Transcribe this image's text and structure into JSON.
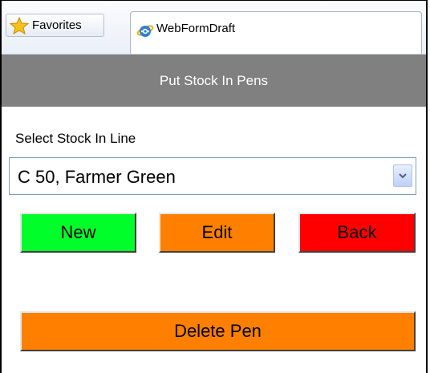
{
  "browser": {
    "favorites_label": "Favorites",
    "tab_title": "WebFormDraft",
    "icons": {
      "favorites": "star-icon",
      "tab": "ie-icon"
    }
  },
  "page": {
    "header_title": "Put Stock In Pens",
    "select_label": "Select Stock In Line",
    "dropdown": {
      "selected_value": "C 50, Farmer Green"
    },
    "buttons": {
      "new_label": "New",
      "edit_label": "Edit",
      "back_label": "Back",
      "delete_label": "Delete Pen"
    }
  },
  "colors": {
    "header_bg": "#808080",
    "new_button": "#00ff2a",
    "edit_button": "#ff8000",
    "back_button": "#ff0000",
    "delete_button": "#ff8000"
  }
}
